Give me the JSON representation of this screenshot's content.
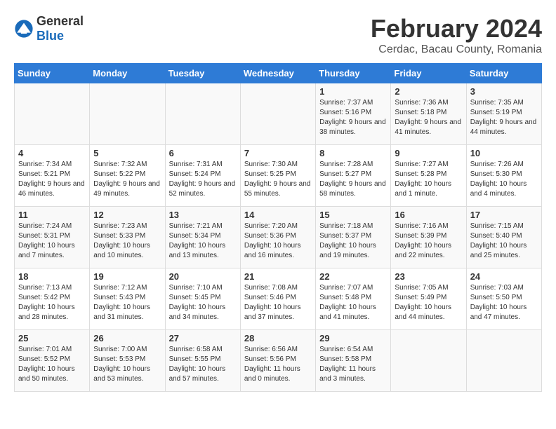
{
  "logo": {
    "general": "General",
    "blue": "Blue"
  },
  "title": "February 2024",
  "location": "Cerdac, Bacau County, Romania",
  "headers": [
    "Sunday",
    "Monday",
    "Tuesday",
    "Wednesday",
    "Thursday",
    "Friday",
    "Saturday"
  ],
  "weeks": [
    [
      {
        "day": "",
        "info": ""
      },
      {
        "day": "",
        "info": ""
      },
      {
        "day": "",
        "info": ""
      },
      {
        "day": "",
        "info": ""
      },
      {
        "day": "1",
        "info": "Sunrise: 7:37 AM\nSunset: 5:16 PM\nDaylight: 9 hours\nand 38 minutes."
      },
      {
        "day": "2",
        "info": "Sunrise: 7:36 AM\nSunset: 5:18 PM\nDaylight: 9 hours\nand 41 minutes."
      },
      {
        "day": "3",
        "info": "Sunrise: 7:35 AM\nSunset: 5:19 PM\nDaylight: 9 hours\nand 44 minutes."
      }
    ],
    [
      {
        "day": "4",
        "info": "Sunrise: 7:34 AM\nSunset: 5:21 PM\nDaylight: 9 hours\nand 46 minutes."
      },
      {
        "day": "5",
        "info": "Sunrise: 7:32 AM\nSunset: 5:22 PM\nDaylight: 9 hours\nand 49 minutes."
      },
      {
        "day": "6",
        "info": "Sunrise: 7:31 AM\nSunset: 5:24 PM\nDaylight: 9 hours\nand 52 minutes."
      },
      {
        "day": "7",
        "info": "Sunrise: 7:30 AM\nSunset: 5:25 PM\nDaylight: 9 hours\nand 55 minutes."
      },
      {
        "day": "8",
        "info": "Sunrise: 7:28 AM\nSunset: 5:27 PM\nDaylight: 9 hours\nand 58 minutes."
      },
      {
        "day": "9",
        "info": "Sunrise: 7:27 AM\nSunset: 5:28 PM\nDaylight: 10 hours\nand 1 minute."
      },
      {
        "day": "10",
        "info": "Sunrise: 7:26 AM\nSunset: 5:30 PM\nDaylight: 10 hours\nand 4 minutes."
      }
    ],
    [
      {
        "day": "11",
        "info": "Sunrise: 7:24 AM\nSunset: 5:31 PM\nDaylight: 10 hours\nand 7 minutes."
      },
      {
        "day": "12",
        "info": "Sunrise: 7:23 AM\nSunset: 5:33 PM\nDaylight: 10 hours\nand 10 minutes."
      },
      {
        "day": "13",
        "info": "Sunrise: 7:21 AM\nSunset: 5:34 PM\nDaylight: 10 hours\nand 13 minutes."
      },
      {
        "day": "14",
        "info": "Sunrise: 7:20 AM\nSunset: 5:36 PM\nDaylight: 10 hours\nand 16 minutes."
      },
      {
        "day": "15",
        "info": "Sunrise: 7:18 AM\nSunset: 5:37 PM\nDaylight: 10 hours\nand 19 minutes."
      },
      {
        "day": "16",
        "info": "Sunrise: 7:16 AM\nSunset: 5:39 PM\nDaylight: 10 hours\nand 22 minutes."
      },
      {
        "day": "17",
        "info": "Sunrise: 7:15 AM\nSunset: 5:40 PM\nDaylight: 10 hours\nand 25 minutes."
      }
    ],
    [
      {
        "day": "18",
        "info": "Sunrise: 7:13 AM\nSunset: 5:42 PM\nDaylight: 10 hours\nand 28 minutes."
      },
      {
        "day": "19",
        "info": "Sunrise: 7:12 AM\nSunset: 5:43 PM\nDaylight: 10 hours\nand 31 minutes."
      },
      {
        "day": "20",
        "info": "Sunrise: 7:10 AM\nSunset: 5:45 PM\nDaylight: 10 hours\nand 34 minutes."
      },
      {
        "day": "21",
        "info": "Sunrise: 7:08 AM\nSunset: 5:46 PM\nDaylight: 10 hours\nand 37 minutes."
      },
      {
        "day": "22",
        "info": "Sunrise: 7:07 AM\nSunset: 5:48 PM\nDaylight: 10 hours\nand 41 minutes."
      },
      {
        "day": "23",
        "info": "Sunrise: 7:05 AM\nSunset: 5:49 PM\nDaylight: 10 hours\nand 44 minutes."
      },
      {
        "day": "24",
        "info": "Sunrise: 7:03 AM\nSunset: 5:50 PM\nDaylight: 10 hours\nand 47 minutes."
      }
    ],
    [
      {
        "day": "25",
        "info": "Sunrise: 7:01 AM\nSunset: 5:52 PM\nDaylight: 10 hours\nand 50 minutes."
      },
      {
        "day": "26",
        "info": "Sunrise: 7:00 AM\nSunset: 5:53 PM\nDaylight: 10 hours\nand 53 minutes."
      },
      {
        "day": "27",
        "info": "Sunrise: 6:58 AM\nSunset: 5:55 PM\nDaylight: 10 hours\nand 57 minutes."
      },
      {
        "day": "28",
        "info": "Sunrise: 6:56 AM\nSunset: 5:56 PM\nDaylight: 11 hours\nand 0 minutes."
      },
      {
        "day": "29",
        "info": "Sunrise: 6:54 AM\nSunset: 5:58 PM\nDaylight: 11 hours\nand 3 minutes."
      },
      {
        "day": "",
        "info": ""
      },
      {
        "day": "",
        "info": ""
      }
    ]
  ]
}
